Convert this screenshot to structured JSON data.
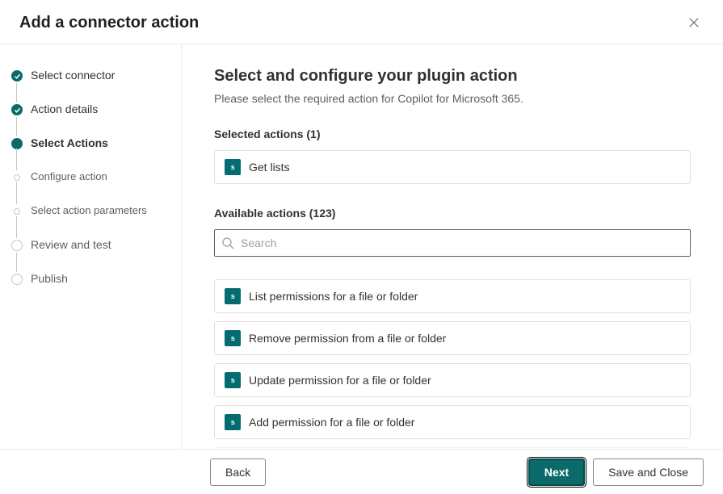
{
  "header": {
    "title": "Add a connector action"
  },
  "steps": [
    {
      "label": "Select connector",
      "state": "done"
    },
    {
      "label": "Action details",
      "state": "done"
    },
    {
      "label": "Select Actions",
      "state": "active"
    },
    {
      "label": "Configure action",
      "state": "sub"
    },
    {
      "label": "Select action parameters",
      "state": "sub"
    },
    {
      "label": "Review and test",
      "state": "pending"
    },
    {
      "label": "Publish",
      "state": "pending"
    }
  ],
  "main": {
    "title": "Select and configure your plugin action",
    "subtitle": "Please select the required action for Copilot for Microsoft 365.",
    "selected_label": "Selected actions (1)",
    "available_label": "Available actions (123)",
    "search_placeholder": "Search"
  },
  "selected_actions": [
    {
      "name": "Get lists"
    }
  ],
  "available_actions": [
    {
      "name": "List permissions for a file or folder"
    },
    {
      "name": "Remove permission from a file or folder"
    },
    {
      "name": "Update permission for a file or folder"
    },
    {
      "name": "Add permission for a file or folder"
    }
  ],
  "footer": {
    "back": "Back",
    "next": "Next",
    "save": "Save and Close"
  },
  "icon_text": "s"
}
